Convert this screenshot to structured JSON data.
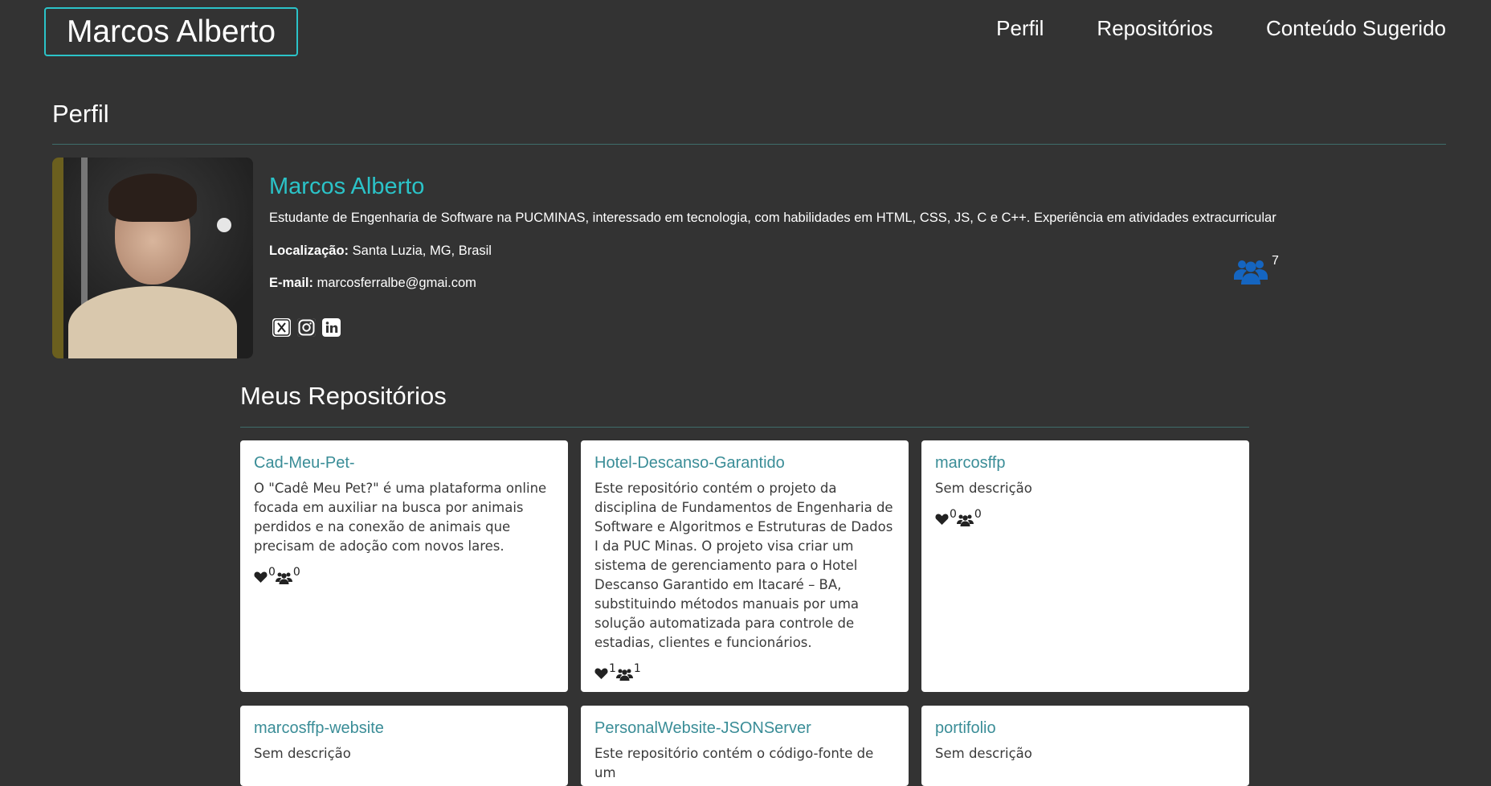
{
  "header": {
    "brand": "Marcos Alberto",
    "nav": [
      "Perfil",
      "Repositórios",
      "Conteúdo Sugerido"
    ]
  },
  "profile": {
    "section_title": "Perfil",
    "name": "Marcos Alberto",
    "bio": "Estudante de Engenharia de Software na PUCMINAS, interessado em tecnologia, com habilidades em HTML, CSS, JS, C e C++. Experiência em atividades extracurricular",
    "location_label": "Localização:",
    "location": "Santa Luzia, MG, Brasil",
    "email_label": "E-mail:",
    "email": "marcosferralbe@gmai.com",
    "socials": [
      "x-icon",
      "instagram-icon",
      "linkedin-icon"
    ],
    "followers": "7"
  },
  "repos": {
    "section_title": "Meus Repositórios",
    "items": [
      {
        "title": "Cad-Meu-Pet-",
        "desc": "O \"Cadê Meu Pet?\" é uma plataforma online focada em auxiliar na busca por animais perdidos e na conexão de animais que precisam de adoção com novos lares.",
        "likes": "0",
        "people": "0"
      },
      {
        "title": "Hotel-Descanso-Garantido",
        "desc": "Este repositório contém o projeto da disciplina de Fundamentos de Engenharia de Software e Algoritmos e Estruturas de Dados I da PUC Minas. O projeto visa criar um sistema de gerenciamento para o Hotel Descanso Garantido em Itacaré – BA, substituindo métodos manuais por uma solução automatizada para controle de estadias, clientes e funcionários.",
        "likes": "1",
        "people": "1"
      },
      {
        "title": "marcosffp",
        "desc": "Sem descrição",
        "likes": "0",
        "people": "0"
      },
      {
        "title": "marcosffp-website",
        "desc": "Sem descrição"
      },
      {
        "title": "PersonalWebsite-JSONServer",
        "desc": "Este repositório contém o código-fonte de um"
      },
      {
        "title": "portifolio",
        "desc": "Sem descrição"
      }
    ]
  },
  "colors": {
    "accent": "#2bc3c8",
    "background": "#333333",
    "link": "#3a8d97",
    "follower_icon": "#1565c0"
  }
}
